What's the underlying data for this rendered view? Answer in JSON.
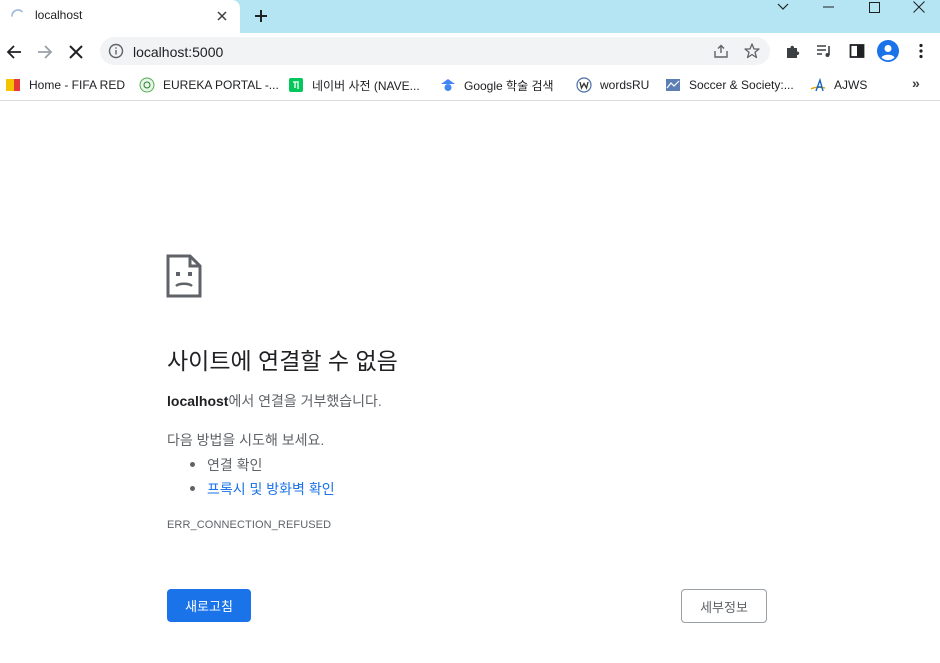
{
  "tab": {
    "title": "localhost"
  },
  "window_controls": [
    "chevron-down-icon",
    "minimize-icon",
    "maximize-icon",
    "close-icon"
  ],
  "toolbar": {
    "url": "localhost:5000",
    "icons": [
      "back-arrow-icon",
      "forward-arrow-icon",
      "stop-loading-icon",
      "site-info-icon",
      "share-icon",
      "bookmark-star-icon",
      "extensions-puzzle-icon",
      "media-queue-icon",
      "side-panel-icon",
      "profile-avatar-icon",
      "kebab-menu-icon"
    ]
  },
  "bookmarks": [
    {
      "label": "Home - FIFA RED",
      "icon": "fifa-icon"
    },
    {
      "label": "EUREKA PORTAL -...",
      "icon": "eureka-icon"
    },
    {
      "label": "네이버 사전 (NAVE...",
      "icon": "naver-dictionary-icon"
    },
    {
      "label": "Google 학술 검색",
      "icon": "google-scholar-icon"
    },
    {
      "label": "wordsRU",
      "icon": "wordsru-icon"
    },
    {
      "label": "Soccer & Society:...",
      "icon": "soccer-society-icon"
    },
    {
      "label": "AJWS",
      "icon": "ajws-icon"
    }
  ],
  "error": {
    "title": "사이트에 연결할 수 없음",
    "host": "localhost",
    "desc_suffix": "에서 연결을 거부했습니다.",
    "try_label": "다음 방법을 시도해 보세요.",
    "suggestions": [
      {
        "text": "연결 확인",
        "link": false
      },
      {
        "text": "프록시 및 방화벽 확인",
        "link": true
      }
    ],
    "code": "ERR_CONNECTION_REFUSED",
    "reload_label": "새로고침",
    "details_label": "세부정보"
  },
  "colors": {
    "tabstrip": "#b5e4f2",
    "accent": "#1a73e8",
    "muted_text": "#5f6368"
  }
}
